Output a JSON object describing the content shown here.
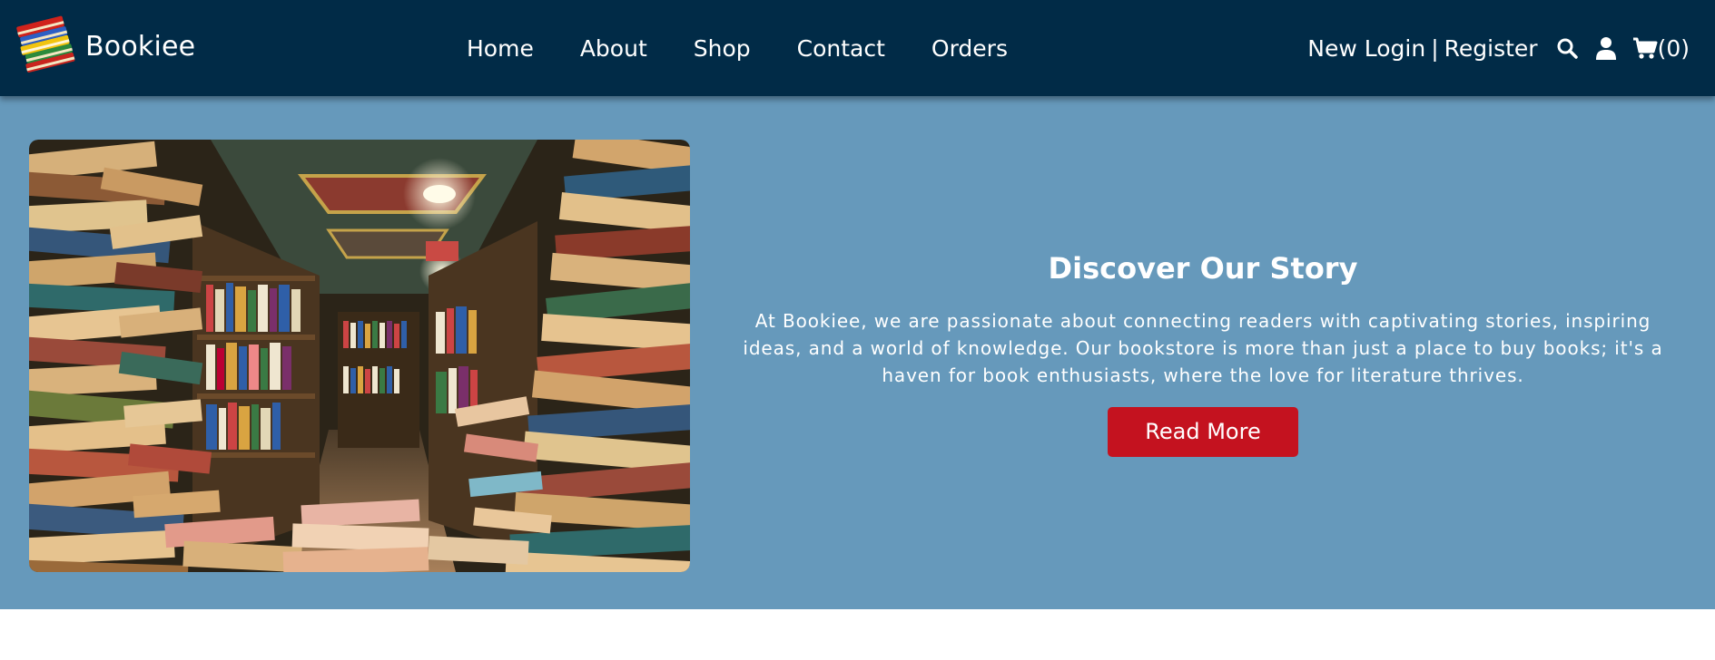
{
  "brand": {
    "name": "Bookiee",
    "logo_icon": "books-stack-icon"
  },
  "nav": {
    "links": [
      {
        "label": "Home"
      },
      {
        "label": "About"
      },
      {
        "label": "Shop"
      },
      {
        "label": "Contact"
      },
      {
        "label": "Orders"
      }
    ]
  },
  "auth": {
    "login_label": "New Login",
    "separator": "|",
    "register_label": "Register"
  },
  "icons": {
    "search": "search-icon",
    "user": "user-icon",
    "cart": "cart-icon"
  },
  "cart": {
    "count_label": "(0)"
  },
  "hero": {
    "image_subject": "bookstore-aisle-image",
    "title": "Discover Our Story",
    "paragraph": "At Bookiee, we are passionate about connecting readers with captivating stories, inspiring ideas, and a world of knowledge. Our bookstore is more than just a place to buy books; it's a haven for book enthusiasts, where the love for literature thrives.",
    "button_label": "Read More"
  },
  "colors": {
    "navbar_bg": "#012b47",
    "hero_bg": "#6699bb",
    "button_bg": "#c4121f",
    "text": "#ffffff"
  }
}
